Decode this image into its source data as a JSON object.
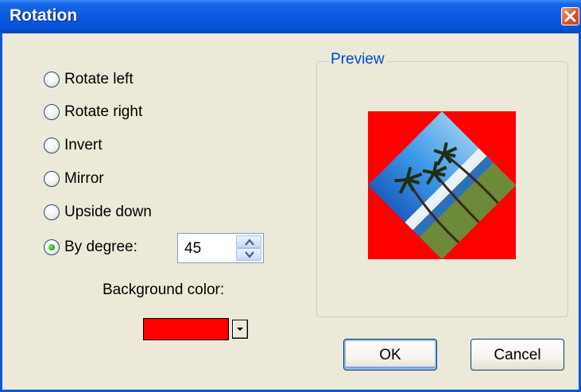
{
  "window": {
    "title": "Rotation"
  },
  "options": [
    {
      "label": "Rotate left",
      "checked": false
    },
    {
      "label": "Rotate right",
      "checked": false
    },
    {
      "label": "Invert",
      "checked": false
    },
    {
      "label": "Mirror",
      "checked": false
    },
    {
      "label": "Upside down",
      "checked": false
    },
    {
      "label": "By degree:",
      "checked": true
    }
  ],
  "degree": {
    "value": "45"
  },
  "background": {
    "label": "Background color:",
    "color": "#ff0000"
  },
  "preview": {
    "title": "Preview",
    "rotation_degrees": 45,
    "icons": [
      "palm-tree-image"
    ]
  },
  "buttons": {
    "ok": "OK",
    "cancel": "Cancel"
  },
  "colors": {
    "title_bar": "#0a58e0",
    "group_title": "#0046d5",
    "dialog_bg": "#ece9d8",
    "close_button": "#e2582f"
  },
  "icons": {
    "close": "close-icon",
    "spin_up": "chevron-up-icon",
    "spin_down": "chevron-down-icon",
    "dropdown": "chevron-down-icon"
  }
}
